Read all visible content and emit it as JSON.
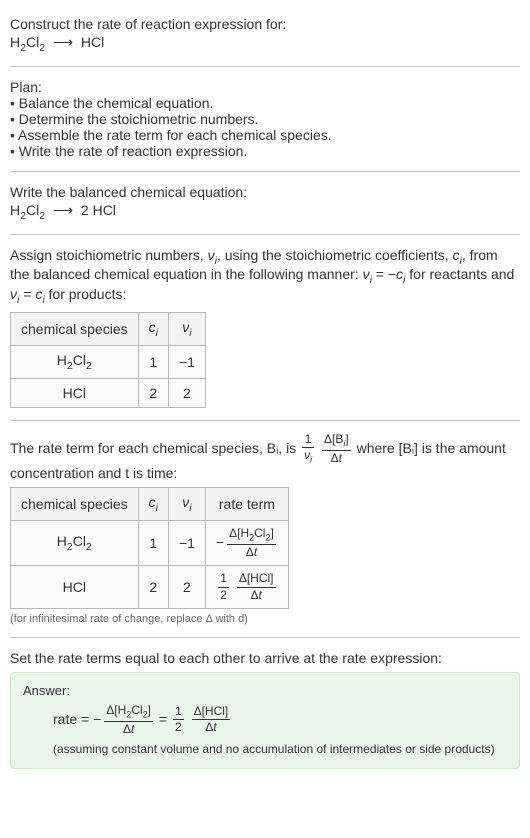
{
  "header": {
    "prompt": "Construct the rate of reaction expression for:",
    "unbalanced_lhs": "H₂Cl₂",
    "arrow": "⟶",
    "unbalanced_rhs": "HCl"
  },
  "plan": {
    "title": "Plan:",
    "items": [
      "Balance the chemical equation.",
      "Determine the stoichiometric numbers.",
      "Assemble the rate term for each chemical species.",
      "Write the rate of reaction expression."
    ]
  },
  "balanced": {
    "title": "Write the balanced chemical equation:",
    "lhs": "H₂Cl₂",
    "arrow": "⟶",
    "rhs": "2 HCl"
  },
  "stoich": {
    "intro_a": "Assign stoichiometric numbers, νᵢ, using the stoichiometric coefficients, cᵢ, from the balanced chemical equation in the following manner: νᵢ = −cᵢ for reactants and νᵢ = cᵢ for products:",
    "headers": [
      "chemical species",
      "cᵢ",
      "νᵢ"
    ],
    "rows": [
      {
        "species": "H₂Cl₂",
        "c": "1",
        "nu": "−1"
      },
      {
        "species": "HCl",
        "c": "2",
        "nu": "2"
      }
    ]
  },
  "rateterm": {
    "intro_pre": "The rate term for each chemical species, Bᵢ, is ",
    "intro_post": " where [Bᵢ] is the amount concentration and t is time:",
    "headers": [
      "chemical species",
      "cᵢ",
      "νᵢ",
      "rate term"
    ],
    "rows": [
      {
        "species": "H₂Cl₂",
        "c": "1",
        "nu": "−1"
      },
      {
        "species": "HCl",
        "c": "2",
        "nu": "2"
      }
    ],
    "note": "(for infinitesimal rate of change, replace Δ with d)"
  },
  "setequal": {
    "text": "Set the rate terms equal to each other to arrive at the rate expression:"
  },
  "answer": {
    "label": "Answer:",
    "rate_prefix": "rate = ",
    "assume": "(assuming constant volume and no accumulation of intermediates or side products)"
  },
  "chart_data": {
    "type": "table",
    "tables": [
      {
        "title": "stoichiometric numbers",
        "columns": [
          "chemical species",
          "c_i",
          "nu_i"
        ],
        "rows": [
          [
            "H2Cl2",
            1,
            -1
          ],
          [
            "HCl",
            2,
            2
          ]
        ]
      },
      {
        "title": "rate terms",
        "columns": [
          "chemical species",
          "c_i",
          "nu_i",
          "rate term"
        ],
        "rows": [
          [
            "H2Cl2",
            1,
            -1,
            "-(Δ[H2Cl2]/Δt)"
          ],
          [
            "HCl",
            2,
            2,
            "(1/2)(Δ[HCl]/Δt)"
          ]
        ]
      }
    ],
    "rate_expression": "rate = -(Δ[H2Cl2]/Δt) = (1/2)(Δ[HCl]/Δt)"
  }
}
